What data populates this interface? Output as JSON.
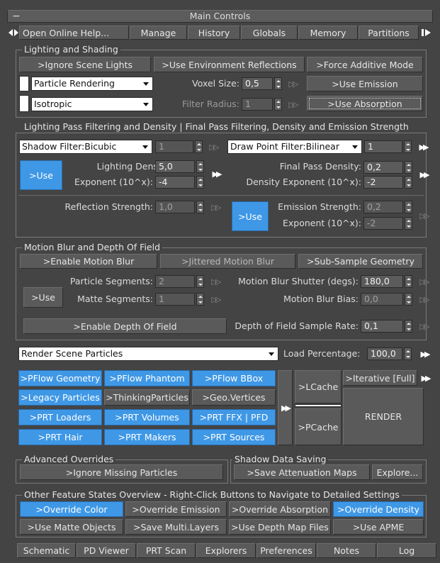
{
  "window": {
    "title": "Main Controls",
    "collapse_glyph": "−"
  },
  "toolbar": {
    "items": [
      "Open Online Help...",
      "Manage",
      "History",
      "Globals",
      "Memory",
      "Partitions"
    ],
    "left_icon": "arrows-left-right-icon",
    "right_icon": "arrow-right-bar-icon"
  },
  "lighting": {
    "title": "Lighting and Shading",
    "ignore_scene_lights": ">Ignore Scene Lights",
    "use_env_reflections": ">Use Environment Reflections",
    "force_additive": ">Force Additive Mode",
    "render_mode": "Particle Rendering",
    "phase_mode": "Isotropic",
    "voxel_size_label": "Voxel Size:",
    "voxel_size": "0,5",
    "filter_radius_label": "Filter Radius:",
    "filter_radius": "1",
    "use_emission": ">Use Emission",
    "use_absorption": ">Use Absorption"
  },
  "pass_filtering": {
    "title": "Lighting Pass Filtering and Density | Final Pass Filtering, Density and Emission Strength",
    "shadow_filter": "Shadow Filter:Bicubic",
    "shadow_filter_value": "1",
    "draw_point_filter": "Draw Point Filter:Bilinear",
    "draw_point_value": "1",
    "use_label": ">Use",
    "lighting_density_label": "Lighting Density:",
    "lighting_density": "5,0",
    "exponent_label": "Exponent (10^x):",
    "exponent": "-4",
    "final_pass_density_label": "Final Pass Density:",
    "final_pass_density": "0,2",
    "density_exponent_label": "Density Exponent (10^x):",
    "density_exponent": "-2",
    "reflection_strength_label": "Reflection Strength:",
    "reflection_strength": "1,0",
    "use2_label": ">Use",
    "emission_strength_label": "Emission Strength:",
    "emission_strength": "0,2",
    "emission_exponent_label": "Exponent (10^x):",
    "emission_exponent": "-2"
  },
  "motion_blur": {
    "title": "Motion Blur and Depth Of Field",
    "enable_motion_blur": ">Enable Motion Blur",
    "jittered_motion_blur": ">Jittered Motion Blur",
    "sub_sample_geometry": ">Sub-Sample Geometry",
    "particle_segments_label": "Particle Segments:",
    "particle_segments": "2",
    "matte_segments_label": "Matte Segments:",
    "matte_segments": "1",
    "use_label": ">Use",
    "shutter_label": "Motion Blur Shutter (degs):",
    "shutter": "180,0",
    "bias_label": "Motion Blur Bias:",
    "bias": "0,0",
    "enable_dof": ">Enable Depth Of Field",
    "dof_rate_label": "Depth of Field Sample Rate:",
    "dof_rate": "0,1"
  },
  "render": {
    "scene_particles": "Render Scene Particles",
    "load_percentage_label": "Load Percentage:",
    "load_percentage": "100,0",
    "sources": [
      [
        ">PFlow Geometry",
        ">PFlow Phantom",
        ">PFlow BBox"
      ],
      [
        ">Legacy Particles",
        ">ThinkingParticles",
        ">Geo.Vertices"
      ],
      [
        ">PRT Loaders",
        ">PRT Volumes",
        ">PRT FFX | PFD"
      ],
      [
        ">PRT Hair",
        ">PRT Makers",
        ">PRT Sources"
      ]
    ],
    "lcache": ">LCache",
    "pcache": ">PCache",
    "iterative": ">Iterative [Full]",
    "render_button": "RENDER"
  },
  "advanced": {
    "title": "Advanced Overrides",
    "ignore_missing": ">Ignore Missing Particles"
  },
  "shadow_saving": {
    "title": "Shadow Data Saving",
    "save_attenuation": ">Save Attenuation Maps",
    "explore": "Explore..."
  },
  "overview": {
    "title": "Other Feature States Overview - Right-Click Buttons to Navigate to Detailed Settings",
    "row1": [
      ">Override Color",
      ">Override Emission",
      ">Override Absorption",
      ">Override Density"
    ],
    "row2": [
      ">Use Matte Objects",
      ">Save Multi.Layers",
      ">Use Depth Map Files",
      ">Use APME"
    ]
  },
  "bottom_tabs": [
    "Schematic",
    "PD Viewer",
    "PRT Scan",
    "Explorers",
    "Preferences",
    "Notes",
    "Log"
  ],
  "colors": {
    "accent": "#3f98e6",
    "background": "#444444",
    "button": "#5a5a5a"
  }
}
